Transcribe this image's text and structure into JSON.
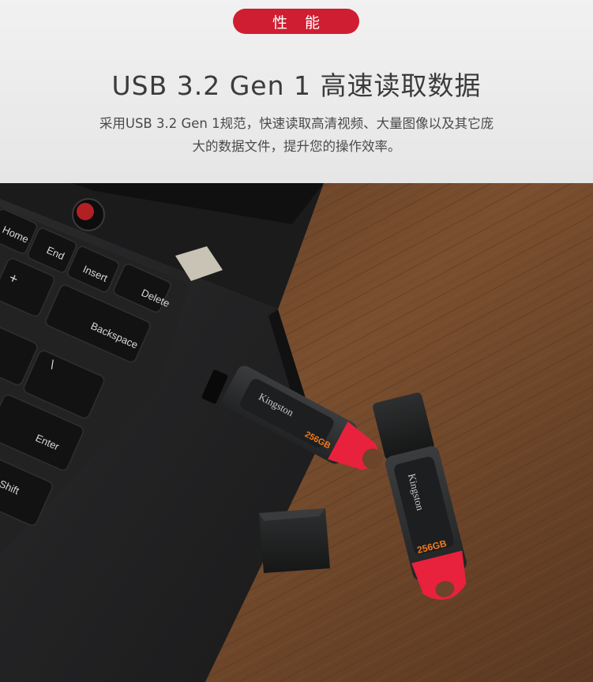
{
  "header": {
    "badge_label": "性 能",
    "title": "USB 3.2 Gen 1 高速读取数据",
    "description_line1": "采用USB 3.2 Gen 1规范，快速读取高清视频、大量图像以及其它庞",
    "description_line2": "大的数据文件，提升您的操作效率。"
  },
  "keyboard": {
    "keys": [
      "Home",
      "End",
      "Insert",
      "Delete",
      "Backspace",
      "Enter",
      "Shift",
      "+",
      "\\"
    ]
  },
  "drives": {
    "brand": "Kingston",
    "capacity": "256GB"
  },
  "colors": {
    "badge": "#cf1e32",
    "accent_red": "#e8213c",
    "capacity_orange": "#f07c1e",
    "wood": "#6b4429"
  }
}
